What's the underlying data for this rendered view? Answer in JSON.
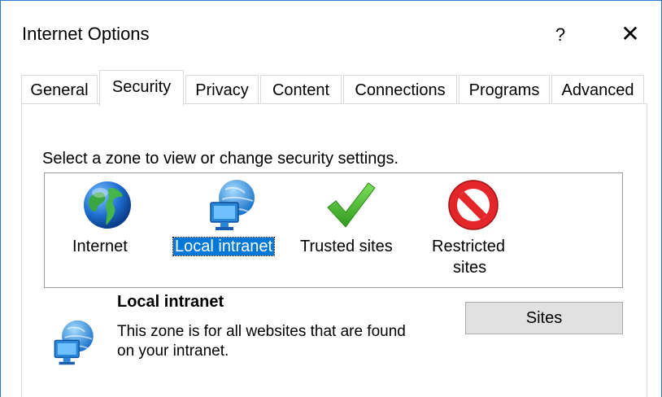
{
  "window": {
    "title": "Internet Options",
    "help_glyph": "?",
    "close_glyph": "✕"
  },
  "tabs": [
    {
      "label": "General"
    },
    {
      "label": "Security",
      "active": true
    },
    {
      "label": "Privacy"
    },
    {
      "label": "Content"
    },
    {
      "label": "Connections"
    },
    {
      "label": "Programs"
    },
    {
      "label": "Advanced"
    }
  ],
  "security": {
    "instruction": "Select a zone to view or change security settings.",
    "zones": [
      {
        "label": "Internet",
        "icon": "globe-icon"
      },
      {
        "label": "Local intranet",
        "icon": "network-globe-icon",
        "selected": true
      },
      {
        "label": "Trusted sites",
        "icon": "checkmark-icon"
      },
      {
        "label_line1": "Restricted",
        "label_line2": "sites",
        "icon": "restricted-icon"
      }
    ],
    "description": {
      "title": "Local intranet",
      "text": "This zone is for all websites that are found on your intranet.",
      "icon": "network-globe-icon"
    },
    "sites_button": "Sites"
  },
  "colors": {
    "accent": "#0078d7",
    "border": "#2b7bd1"
  }
}
